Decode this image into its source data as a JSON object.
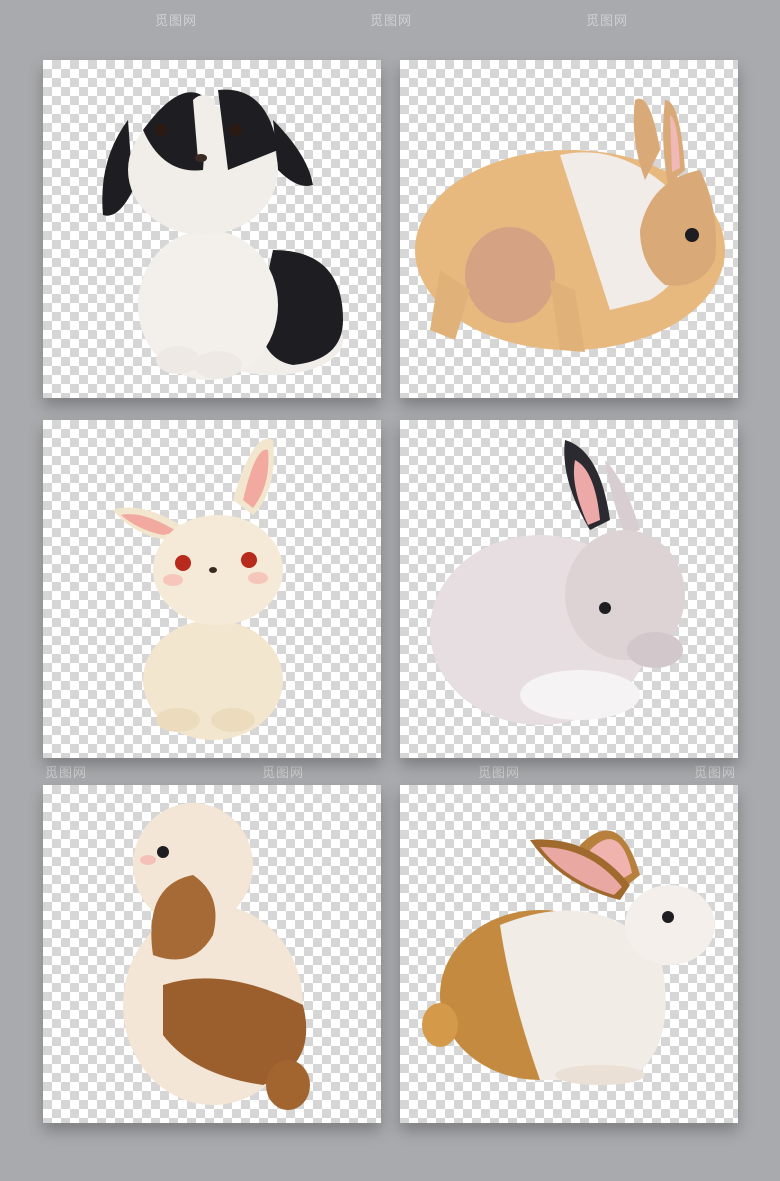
{
  "watermark": "觅图网",
  "palette": {
    "background": "#a9aaad",
    "checker_light": "#ffffff",
    "checker_dark": "#d6d6d6"
  },
  "tiles": [
    {
      "subject": "rabbit",
      "icon": "rabbit-black-white-sitting"
    },
    {
      "subject": "rabbit",
      "icon": "rabbit-tan-back-view"
    },
    {
      "subject": "rabbit",
      "icon": "rabbit-cream-sitting"
    },
    {
      "subject": "rabbit",
      "icon": "rabbit-grey-grooming"
    },
    {
      "subject": "rabbit",
      "icon": "rabbit-lop-brown-patch"
    },
    {
      "subject": "rabbit",
      "icon": "rabbit-white-brown-crouching"
    }
  ]
}
